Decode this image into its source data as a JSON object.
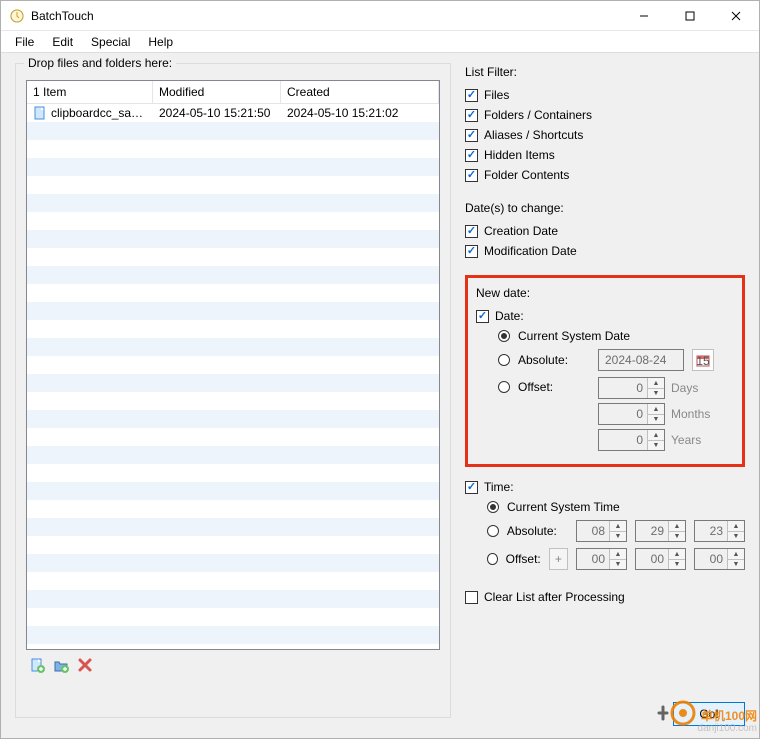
{
  "window": {
    "title": "BatchTouch"
  },
  "menu": {
    "file": "File",
    "edit": "Edit",
    "special": "Special",
    "help": "Help"
  },
  "dropzone": {
    "label": "Drop files and folders here:"
  },
  "list": {
    "header": {
      "count": "1 Item",
      "modified": "Modified",
      "created": "Created"
    },
    "rows": [
      {
        "name": "clipboardcc_save...",
        "modified": "2024-05-10 15:21:50",
        "created": "2024-05-10 15:21:02"
      }
    ]
  },
  "filter": {
    "label": "List Filter:",
    "files": "Files",
    "folders": "Folders / Containers",
    "aliases": "Aliases / Shortcuts",
    "hidden": "Hidden Items",
    "contents": "Folder Contents"
  },
  "dates_change": {
    "label": "Date(s) to change:",
    "creation": "Creation Date",
    "modification": "Modification Date"
  },
  "newdate": {
    "label": "New date:",
    "date_check": "Date:",
    "current": "Current System Date",
    "absolute": "Absolute:",
    "absolute_value": "2024-08-24",
    "offset": "Offset:",
    "offset_days": "0",
    "offset_months": "0",
    "offset_years": "0",
    "unit_days": "Days",
    "unit_months": "Months",
    "unit_years": "Years"
  },
  "time": {
    "check": "Time:",
    "current": "Current System Time",
    "absolute": "Absolute:",
    "h": "08",
    "m": "29",
    "s": "23",
    "offset": "Offset:",
    "oh": "00",
    "om": "00",
    "os": "00"
  },
  "clear_list": "Clear List after Processing",
  "go": "Go!",
  "watermark": {
    "brand": "单机100网",
    "url": "danji100.com"
  }
}
